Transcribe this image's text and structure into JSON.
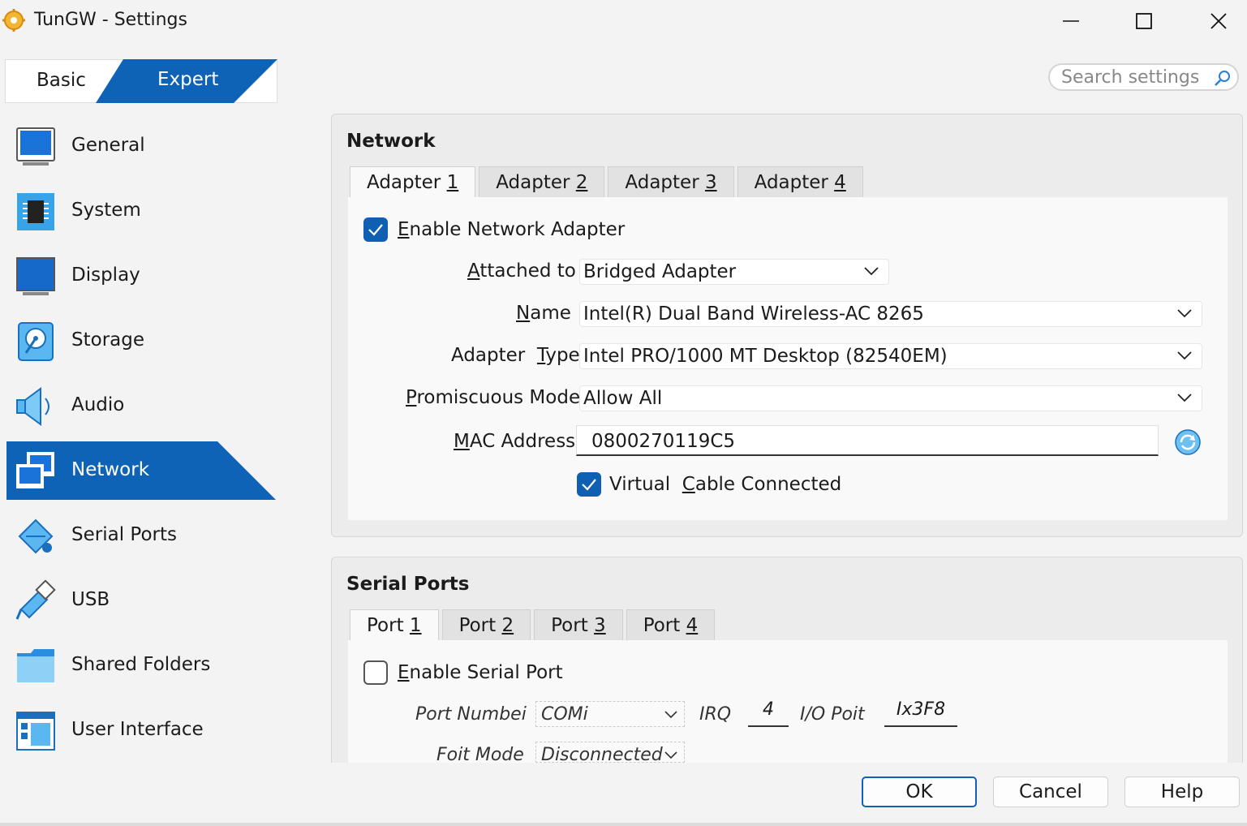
{
  "window": {
    "title": "TunGW - Settings",
    "icons": [
      "settings-gear-icon",
      "minimize-icon",
      "maximize-icon",
      "close-icon"
    ]
  },
  "mode": {
    "basic_label": "Basic",
    "expert_label": "Expert",
    "selected": "Expert"
  },
  "search": {
    "placeholder": "Search settings"
  },
  "sidebar": {
    "items": [
      {
        "label": "General",
        "icon": "general-icon"
      },
      {
        "label": "System",
        "icon": "system-icon"
      },
      {
        "label": "Display",
        "icon": "display-icon"
      },
      {
        "label": "Storage",
        "icon": "storage-icon"
      },
      {
        "label": "Audio",
        "icon": "audio-icon"
      },
      {
        "label": "Network",
        "icon": "network-icon",
        "active": true
      },
      {
        "label": "Serial Ports",
        "icon": "serial-ports-icon"
      },
      {
        "label": "USB",
        "icon": "usb-icon"
      },
      {
        "label": "Shared Folders",
        "icon": "shared-folders-icon"
      },
      {
        "label": "User Interface",
        "icon": "user-interface-icon"
      }
    ]
  },
  "network": {
    "title": "Network",
    "tabs": [
      {
        "prefix": "Adapter ",
        "key": "1"
      },
      {
        "prefix": "Adapter ",
        "key": "2"
      },
      {
        "prefix": "Adapter ",
        "key": "3"
      },
      {
        "prefix": "Adapter ",
        "key": "4"
      }
    ],
    "enable_label_key": "E",
    "enable_label_rest": "nable Network Adapter",
    "enable_checked": true,
    "attached_to": {
      "label_key": "A",
      "label_rest": "ttached to",
      "value": "Bridged Adapter"
    },
    "name": {
      "label_key": "N",
      "label_rest": "ame",
      "value": "Intel(R) Dual Band Wireless-AC 8265"
    },
    "adapter_type": {
      "label_pre": "Adapter ",
      "label_key": "T",
      "label_rest": "ype",
      "value": "Intel PRO/1000 MT Desktop (82540EM)"
    },
    "promiscuous": {
      "label_key": "P",
      "label_rest": "romiscuous Mode",
      "value": "Allow All"
    },
    "mac": {
      "label_key": "M",
      "label_rest": "AC Address",
      "value": "0800270119C5"
    },
    "cable": {
      "label_pre": "Virtual ",
      "label_key": "C",
      "label_rest": "able Connected",
      "checked": true
    }
  },
  "serial": {
    "title": "Serial Ports",
    "tabs": [
      {
        "prefix": "Port ",
        "key": "1"
      },
      {
        "prefix": "Port ",
        "key": "2"
      },
      {
        "prefix": "Port ",
        "key": "3"
      },
      {
        "prefix": "Port ",
        "key": "4"
      }
    ],
    "enable_label_key": "E",
    "enable_label_rest": "nable Serial Port",
    "enable_checked": false,
    "port_number_label": "Port Numbei",
    "port_number_value": "COMi",
    "irq_label": "IRQ",
    "irq_value": "4",
    "io_port_label": "I/O Poit",
    "io_port_value": "Ix3F8",
    "port_mode_label": "Foit Mode",
    "port_mode_value": "Disconnected"
  },
  "buttons": {
    "ok": "OK",
    "cancel": "Cancel",
    "help": "Help"
  },
  "colors": {
    "accent": "#0f63b6",
    "selection": "#0f63b6"
  }
}
